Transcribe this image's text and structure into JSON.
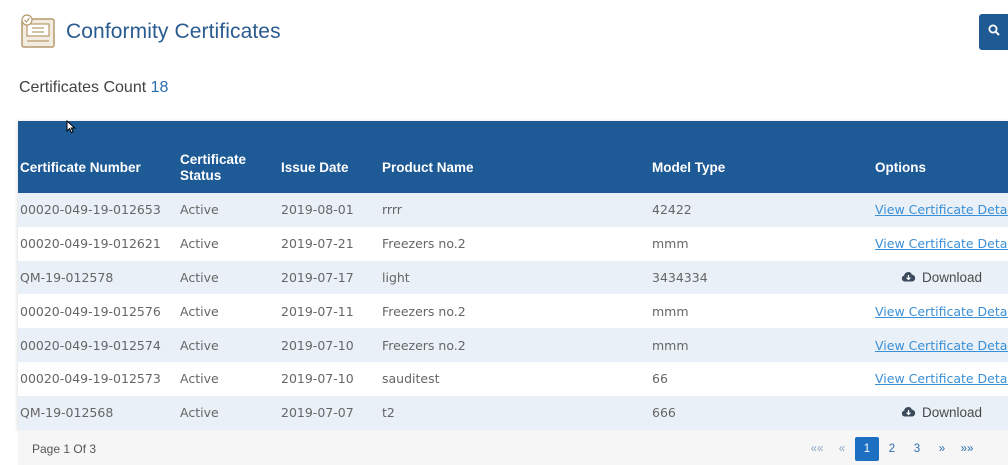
{
  "header": {
    "title": "Conformity Certificates",
    "icon": "certificate-icon",
    "search_icon": "search-icon"
  },
  "summary": {
    "label": "Certificates Count",
    "count": "18"
  },
  "table": {
    "columns": {
      "certificate_number": "Certificate Number",
      "certificate_status_line1": "Certificate",
      "certificate_status_line2": "Status",
      "issue_date": "Issue Date",
      "product_name": "Product Name",
      "model_type": "Model Type",
      "options": "Options"
    },
    "rows": [
      {
        "number": "00020-049-19-012653",
        "status": "Active",
        "date": "2019-08-01",
        "product": "rrrr",
        "model": "42422",
        "option": "View Certificate Details",
        "option_type": "link"
      },
      {
        "number": "00020-049-19-012621",
        "status": "Active",
        "date": "2019-07-21",
        "product": "Freezers no.2",
        "model": "mmm",
        "option": "View Certificate Details",
        "option_type": "link"
      },
      {
        "number": "QM-19-012578",
        "status": "Active",
        "date": "2019-07-17",
        "product": "light",
        "model": "3434334",
        "option": "Download",
        "option_type": "download"
      },
      {
        "number": "00020-049-19-012576",
        "status": "Active",
        "date": "2019-07-11",
        "product": "Freezers no.2",
        "model": "mmm",
        "option": "View Certificate Details",
        "option_type": "link"
      },
      {
        "number": "00020-049-19-012574",
        "status": "Active",
        "date": "2019-07-10",
        "product": "Freezers no.2",
        "model": "mmm",
        "option": "View Certificate Details",
        "option_type": "link"
      },
      {
        "number": "00020-049-19-012573",
        "status": "Active",
        "date": "2019-07-10",
        "product": "sauditest",
        "model": "66",
        "option": "View Certificate Details",
        "option_type": "link"
      },
      {
        "number": "QM-19-012568",
        "status": "Active",
        "date": "2019-07-07",
        "product": "t2",
        "model": "666",
        "option": "Download",
        "option_type": "download"
      }
    ]
  },
  "footer": {
    "page_info": "Page 1 Of 3",
    "pager": {
      "first": "««",
      "prev": "«",
      "pages": [
        "1",
        "2",
        "3"
      ],
      "active_page": "1",
      "next": "»",
      "last": "»»"
    }
  },
  "colors": {
    "header_blue": "#1d5a96",
    "title_blue": "#2a5b8e",
    "link_blue": "#3a8fd6",
    "row_stripe": "#eaf0f7"
  }
}
